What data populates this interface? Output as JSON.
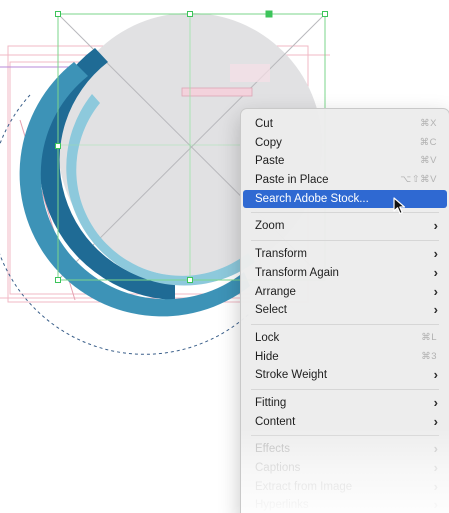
{
  "context_menu": {
    "items": [
      {
        "label": "Cut",
        "shortcut": "⌘X"
      },
      {
        "label": "Copy",
        "shortcut": "⌘C"
      },
      {
        "label": "Paste",
        "shortcut": "⌘V"
      },
      {
        "label": "Paste in Place",
        "shortcut": "⌥⇧⌘V"
      },
      {
        "label": "Search Adobe Stock..."
      },
      {
        "label": "Zoom"
      },
      {
        "label": "Transform"
      },
      {
        "label": "Transform Again"
      },
      {
        "label": "Arrange"
      },
      {
        "label": "Select"
      },
      {
        "label": "Lock",
        "shortcut": "⌘L"
      },
      {
        "label": "Hide",
        "shortcut": "⌘3"
      },
      {
        "label": "Stroke Weight"
      },
      {
        "label": "Fitting"
      },
      {
        "label": "Content"
      },
      {
        "label": "Effects"
      },
      {
        "label": "Captions"
      },
      {
        "label": "Extract from Image"
      },
      {
        "label": "Hyperlinks"
      }
    ],
    "submenu_glyph": "›"
  },
  "colors": {
    "highlight": "#2f69d2",
    "arc_dark_blue": "#1f6b95",
    "arc_mid_blue": "#3d93b7",
    "arc_light_blue": "#8dc9dc",
    "circle_fill": "#e1e1e3",
    "selection_green": "#3cc45a",
    "guide_pink": "#e89aaa",
    "guide_purple": "#a76fd0"
  }
}
